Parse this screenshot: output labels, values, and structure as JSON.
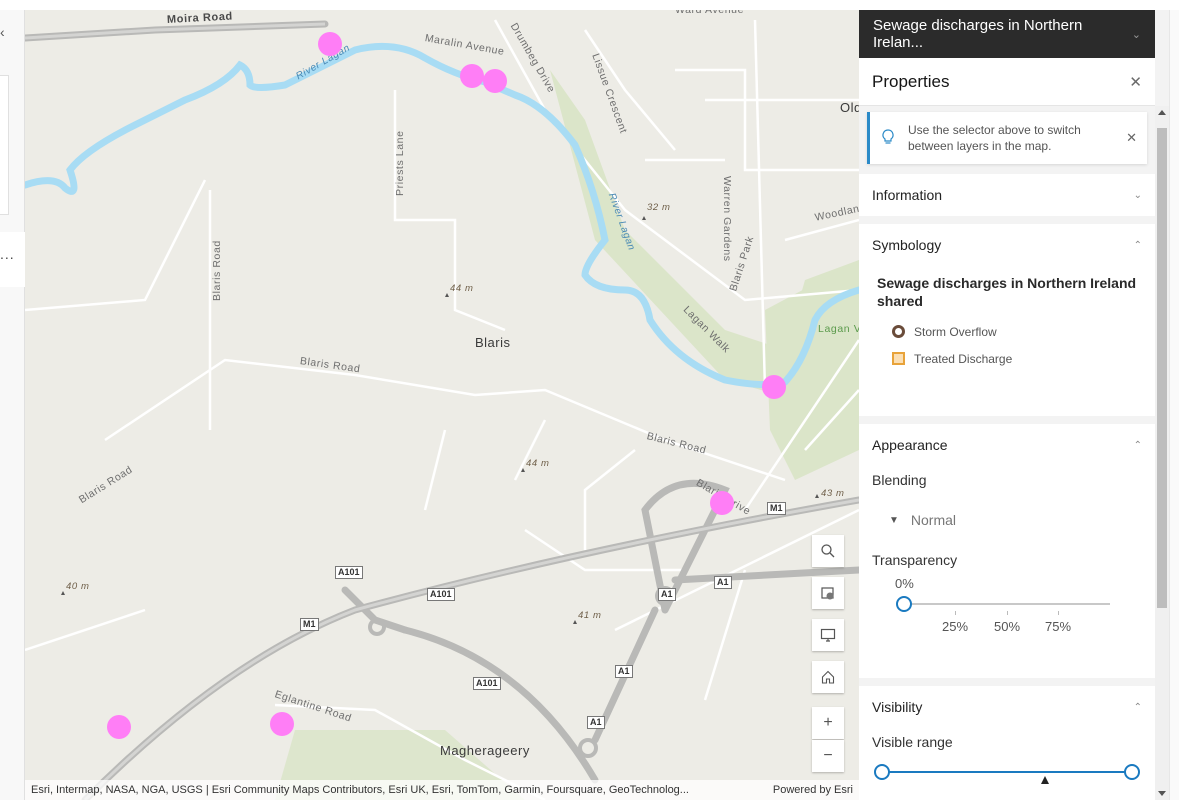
{
  "left_panel": {
    "close_icon": "close-icon",
    "more_icon": "ellipsis-icon",
    "more_label": "..."
  },
  "map": {
    "road_labels": [
      {
        "text": "Moira Road",
        "kind": "bold"
      },
      {
        "text": "Maralin Avenue",
        "kind": "road"
      },
      {
        "text": "Drumbeg Drive",
        "kind": "road"
      },
      {
        "text": "Lissue Crescent",
        "kind": "road"
      },
      {
        "text": "Ward Avenue",
        "kind": "road"
      },
      {
        "text": "Warren Gardens",
        "kind": "road"
      },
      {
        "text": "Priests Lane",
        "kind": "road"
      },
      {
        "text": "Blaris Road",
        "kind": "road"
      },
      {
        "text": "Blaris Road",
        "kind": "road"
      },
      {
        "text": "Blaris Road",
        "kind": "road"
      },
      {
        "text": "Blaris Road",
        "kind": "road"
      },
      {
        "text": "Blaris Park",
        "kind": "road"
      },
      {
        "text": "Lagan Walk",
        "kind": "road"
      },
      {
        "text": "Blaris Drive",
        "kind": "road"
      },
      {
        "text": "Eglantine Road",
        "kind": "road"
      },
      {
        "text": "Woodlan",
        "kind": "road"
      }
    ],
    "place_labels": [
      "Blaris",
      "Magherageery",
      "Old"
    ],
    "river_labels": [
      "River Lagan",
      "River Lagan"
    ],
    "park_labels": [
      "Lagan Va"
    ],
    "elevations": [
      "32 m",
      "44 m",
      "44 m",
      "43 m",
      "40 m",
      "41 m"
    ],
    "shields": [
      "A101",
      "A101",
      "A101",
      "M1",
      "M1",
      "A1",
      "A1",
      "A1",
      "A1"
    ],
    "feature_points": 8,
    "feature_color": "#ff7ef6",
    "controls": [
      {
        "name": "search",
        "icon": "search-icon"
      },
      {
        "name": "basemap",
        "icon": "basemap-gallery-icon"
      },
      {
        "name": "fullscreen",
        "icon": "monitor-icon"
      },
      {
        "name": "home",
        "icon": "home-icon"
      },
      {
        "name": "zoom-in",
        "icon": "plus-icon",
        "label": "+"
      },
      {
        "name": "zoom-out",
        "icon": "minus-icon",
        "label": "−"
      }
    ],
    "attribution": "Esri, Intermap, NASA, NGA, USGS | Esri Community Maps Contributors, Esri UK, Esri, TomTom, Garmin, Foursquare, GeoTechnolog...",
    "powered_by": "Powered by Esri"
  },
  "panel": {
    "layer_selector": "Sewage discharges in Northern Irelan...",
    "properties_title": "Properties",
    "notice": "Use the selector above to switch between layers in the map.",
    "sections": {
      "information": "Information",
      "symbology": "Symbology",
      "appearance": "Appearance",
      "visibility": "Visibility"
    },
    "legend": {
      "title": "Sewage discharges in Northern Ireland shared",
      "items": [
        {
          "label": "Storm Overflow",
          "symbol": "circle-outline",
          "color": "#6a4c3a"
        },
        {
          "label": "Treated Discharge",
          "symbol": "square",
          "color": "#e8a33a"
        }
      ]
    },
    "blending_label": "Blending",
    "blending_value": "Normal",
    "transparency_label": "Transparency",
    "transparency_value": "0%",
    "transparency_percent": 0,
    "transparency_ticks": [
      "25%",
      "50%",
      "75%"
    ],
    "visible_range_label": "Visible range",
    "accent": "#1a7ac0"
  }
}
